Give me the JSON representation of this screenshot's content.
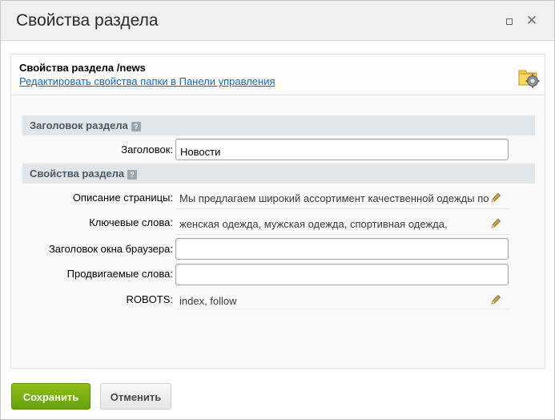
{
  "window": {
    "title": "Свойства раздела"
  },
  "header": {
    "title": "Свойства раздела /news",
    "link": "Редактировать свойства папки в Панели управления"
  },
  "sections": [
    {
      "label": "Заголовок раздела",
      "help_glyph": "?"
    },
    {
      "label": "Свойства раздела",
      "help_glyph": "?"
    }
  ],
  "fields": {
    "title": {
      "label": "Заголовок:",
      "value": "Новости"
    },
    "description": {
      "label": "Описание страницы:",
      "value": "Мы предлагаем широкий ассортимент качественной одежды по"
    },
    "keywords": {
      "label": "Ключевые слова:",
      "value": "женская одежда, мужская одежда, спортивная одежда,"
    },
    "browser_title": {
      "label": "Заголовок окна браузера:",
      "value": ""
    },
    "promoted": {
      "label": "Продвигаемые слова:",
      "value": ""
    },
    "robots": {
      "label": "ROBOTS:",
      "value": "index, follow"
    }
  },
  "buttons": {
    "save": "Сохранить",
    "cancel": "Отменить"
  },
  "colors": {
    "save_button": "#7cb012",
    "link": "#2067b0",
    "section_bg": "#e1e6ea"
  }
}
